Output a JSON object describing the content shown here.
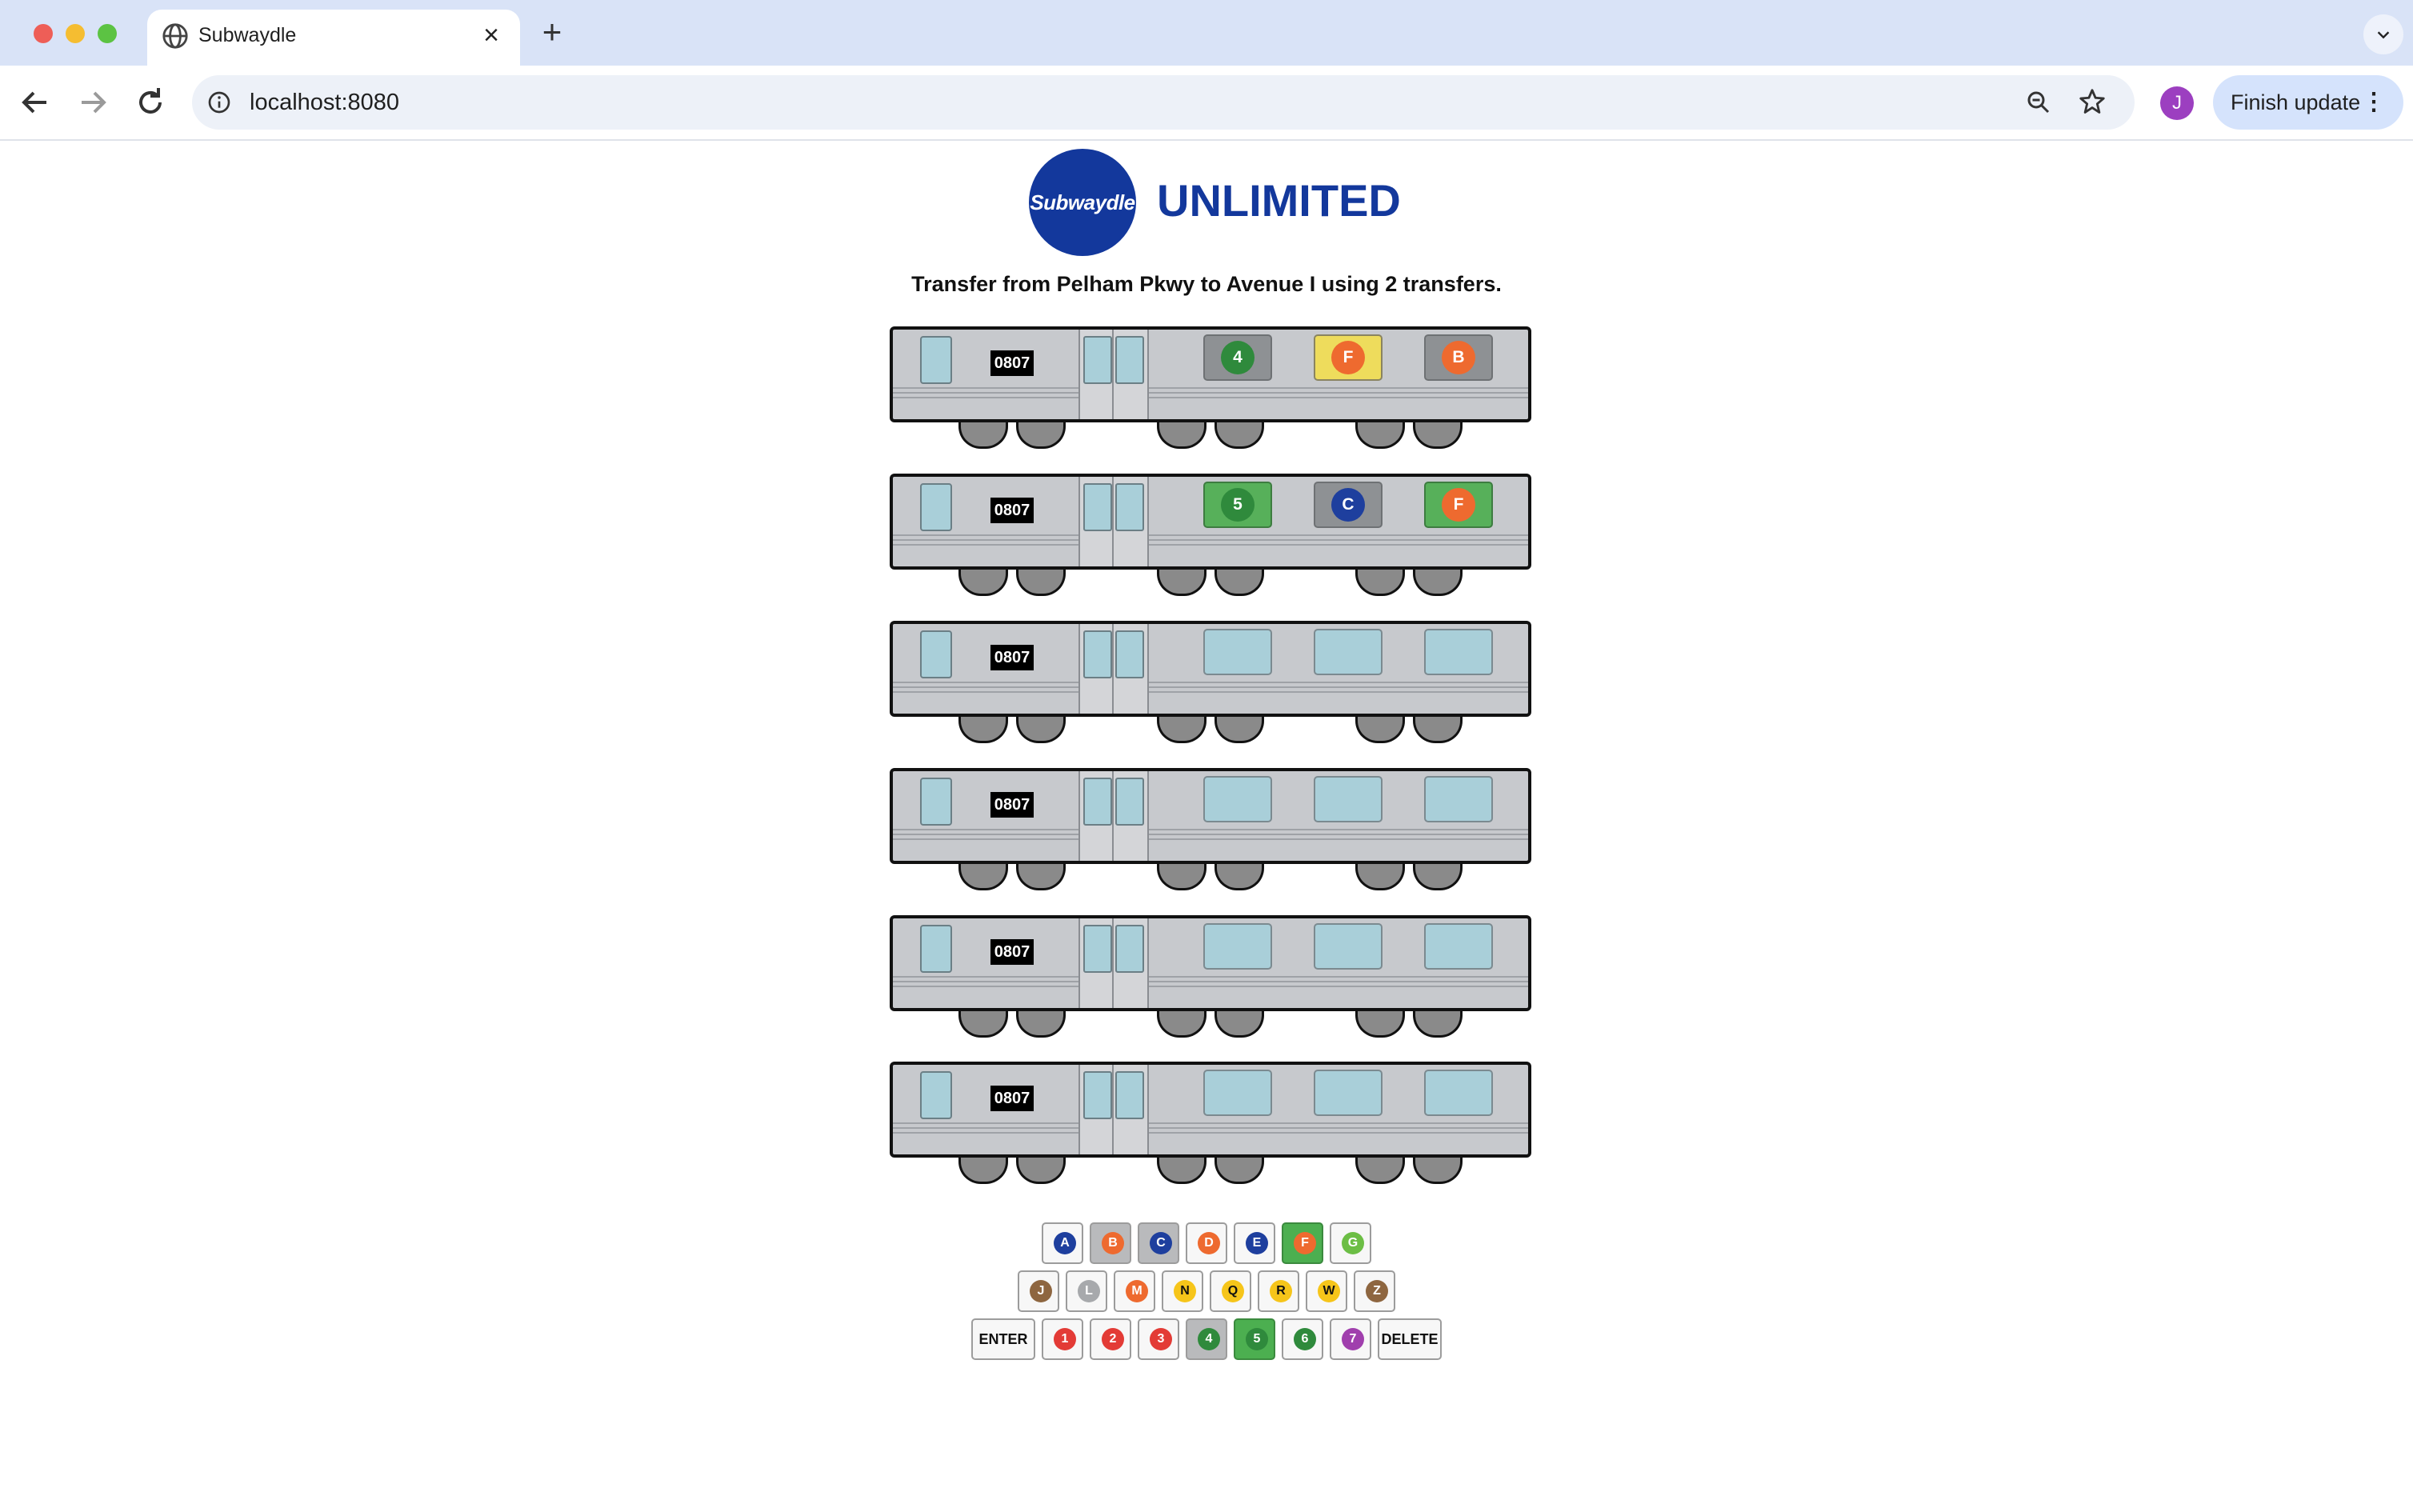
{
  "browser": {
    "tab_title": "Subwaydle",
    "url": "localhost:8080",
    "profile_initial": "J",
    "finish_update_label": "Finish update"
  },
  "header": {
    "logo_text": "Subwaydle",
    "title": "UNLIMITED",
    "instruction": "Transfer from Pelham Pkwy to Avenue I using 2 transfers."
  },
  "car_number": "0807",
  "line_colors": {
    "A": "#1e3f9e",
    "B": "#ee6a2f",
    "C": "#1e3f9e",
    "D": "#ee6a2f",
    "E": "#1e3f9e",
    "F": "#ee6a2f",
    "G": "#6cbe45",
    "J": "#8e6640",
    "L": "#a7a9ac",
    "M": "#ee6a2f",
    "N": "#f6c51a",
    "Q": "#f6c51a",
    "R": "#f6c51a",
    "W": "#f6c51a",
    "Z": "#8e6640",
    "1": "#e33b36",
    "2": "#e33b36",
    "3": "#e33b36",
    "4": "#2f8a3c",
    "5": "#2f8a3c",
    "6": "#2f8a3c",
    "7": "#a03fad"
  },
  "status_colors": {
    "correct": "#57b05a",
    "present": "#eedc5c",
    "absent": "#8e9194",
    "empty": "#a9cfd9"
  },
  "guesses": [
    [
      {
        "line": "4",
        "status": "absent"
      },
      {
        "line": "F",
        "status": "present"
      },
      {
        "line": "B",
        "status": "absent"
      }
    ],
    [
      {
        "line": "5",
        "status": "correct"
      },
      {
        "line": "C",
        "status": "absent"
      },
      {
        "line": "F",
        "status": "correct"
      }
    ],
    [
      {
        "line": "",
        "status": "empty"
      },
      {
        "line": "",
        "status": "empty"
      },
      {
        "line": "",
        "status": "empty"
      }
    ],
    [
      {
        "line": "",
        "status": "empty"
      },
      {
        "line": "",
        "status": "empty"
      },
      {
        "line": "",
        "status": "empty"
      }
    ],
    [
      {
        "line": "",
        "status": "empty"
      },
      {
        "line": "",
        "status": "empty"
      },
      {
        "line": "",
        "status": "empty"
      }
    ],
    [
      {
        "line": "",
        "status": "empty"
      },
      {
        "line": "",
        "status": "empty"
      },
      {
        "line": "",
        "status": "empty"
      }
    ]
  ],
  "keyboard": {
    "rows": [
      [
        "A",
        "B",
        "C",
        "D",
        "E",
        "F",
        "G"
      ],
      [
        "J",
        "L",
        "M",
        "N",
        "Q",
        "R",
        "W",
        "Z"
      ],
      [
        "ENTER",
        "1",
        "2",
        "3",
        "4",
        "5",
        "6",
        "7",
        "DELETE"
      ]
    ],
    "key_status": {
      "B": "absent",
      "C": "absent",
      "F": "correct",
      "4": "absent",
      "5": "correct"
    }
  }
}
